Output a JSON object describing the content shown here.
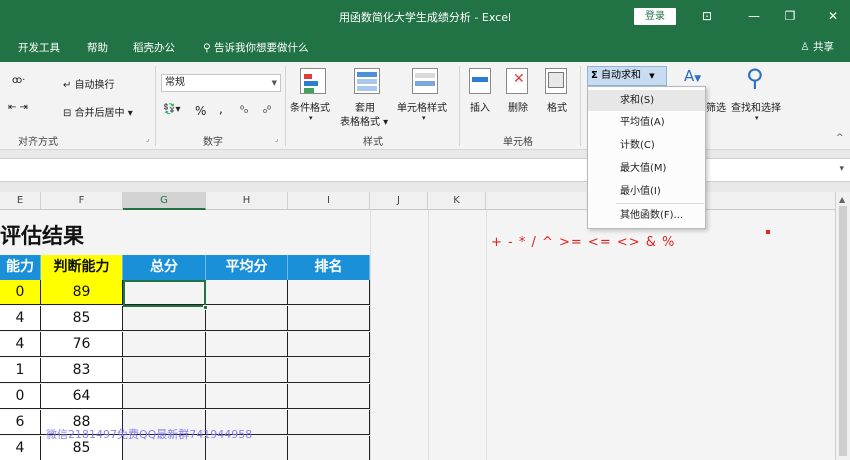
{
  "window": {
    "title": "用函数简化大学生成绩分析 - Excel",
    "login": "登录",
    "controls": [
      "⊡",
      "—",
      "❐",
      "✕"
    ]
  },
  "menu": {
    "items": [
      "开发工具",
      "帮助",
      "稻壳办公"
    ],
    "tell_me": "告诉我你想要做什么",
    "share": "共享"
  },
  "ribbon": {
    "alignment": {
      "wrap_text": "自动换行",
      "merge_center": "合并后居中",
      "label": "对齐方式"
    },
    "number": {
      "format": "常规",
      "percent": "%",
      "comma": ",",
      "label": "数字"
    },
    "styles": {
      "conditional": "条件格式",
      "table_format_1": "套用",
      "table_format_2": "表格格式",
      "cell_styles": "单元格样式",
      "label": "样式"
    },
    "cells": {
      "insert": "插入",
      "delete": "删除",
      "format": "格式",
      "label": "单元格"
    },
    "editing": {
      "autosum": "自动求和",
      "filter": "筛选",
      "find_select": "查找和选择"
    }
  },
  "autosum_menu": {
    "items": [
      "求和(S)",
      "平均值(A)",
      "计数(C)",
      "最大值(M)",
      "最小值(I)",
      "其他函数(F)..."
    ]
  },
  "columns": [
    "E",
    "F",
    "G",
    "H",
    "I",
    "J",
    "K"
  ],
  "sheet": {
    "title": "评估结果",
    "headers": [
      "能力",
      "判断能力",
      "总分",
      "平均分",
      "排名"
    ],
    "col_e": [
      "0",
      "4",
      "4",
      "1",
      "0",
      "6",
      "4"
    ],
    "col_f": [
      "89",
      "85",
      "76",
      "83",
      "64",
      "88",
      "85"
    ],
    "operators": "+ - * / ^ >= <= <> & %",
    "watermark": "微信2181497免费QQ最新群741944958"
  },
  "colors": {
    "excel_green": "#217346",
    "header_blue": "#1a90d8",
    "highlight_yellow": "#ffff00",
    "operator_red": "#e32222"
  }
}
